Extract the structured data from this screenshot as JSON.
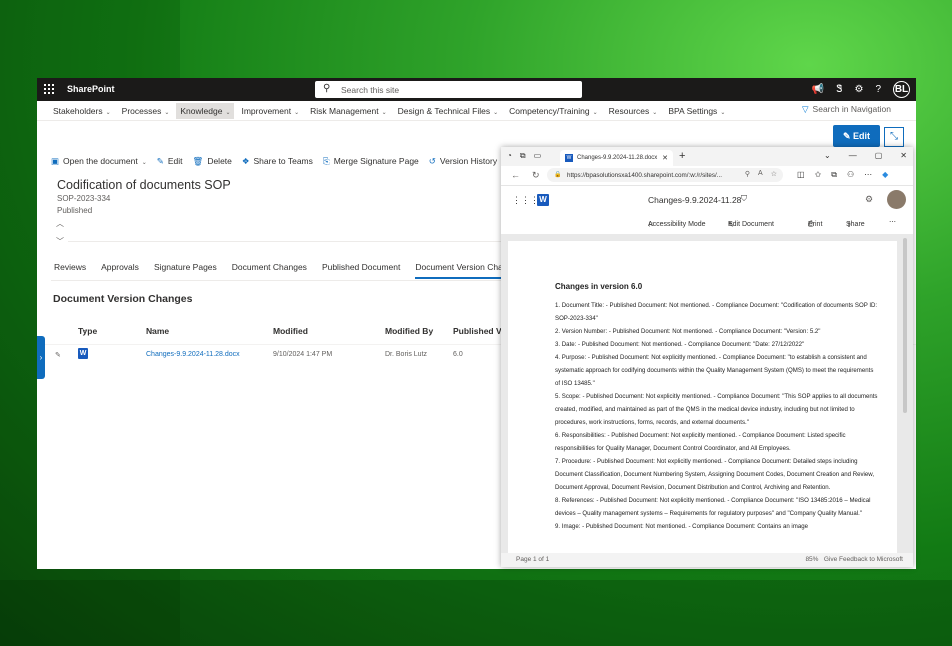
{
  "sharepoint": {
    "brand": "SharePoint",
    "search_placeholder": "Search this site",
    "user_initials": "BL",
    "nav": [
      "Stakeholders",
      "Processes",
      "Knowledge",
      "Improvement",
      "Risk Management",
      "Design & Technical Files",
      "Competency/Training",
      "Resources",
      "BPA Settings"
    ],
    "nav_search": "Search in Navigation",
    "edit_label": "Edit",
    "commands": {
      "open": "Open the document",
      "edit": "Edit",
      "delete": "Delete",
      "share": "Share to Teams",
      "merge": "Merge Signature Page",
      "history": "Version History"
    },
    "doc": {
      "title": "Codification of documents SOP",
      "id": "SOP-2023-334",
      "status": "Published"
    },
    "tabs": [
      "Reviews",
      "Approvals",
      "Signature Pages",
      "Document Changes",
      "Published Document",
      "Document Version Changes"
    ],
    "section_title": "Document Version Changes",
    "table": {
      "headers": [
        "Type",
        "Name",
        "Modified",
        "Modified By",
        "Published Ver"
      ],
      "row": {
        "name": "Changes-9.9.2024-11.28.docx",
        "modified": "9/10/2024 1:47 PM",
        "modified_by": "Dr. Boris Lutz",
        "version": "6.0"
      }
    }
  },
  "edge": {
    "tab_title": "Changes-9.9.2024-11.28.docx",
    "url": "https://bpasolutionsxa1400.sharepoint.com/:w:/r/sites/...",
    "word_title": "Changes-9.9.2024-11.28",
    "toolbar": {
      "accessibility": "Accessibility Mode",
      "edit": "Edit Document",
      "print": "Print",
      "share": "Share"
    },
    "document": {
      "heading": "Changes in version 6.0",
      "items": [
        "1. Document Title:   - Published Document: Not mentioned.    - Compliance Document: \"Codification of documents SOP ID: SOP-2023-334\"",
        "2. Version Number:    - Published Document: Not mentioned.    - Compliance Document: \"Version: 5.2\"",
        "3. Date:    - Published Document: Not mentioned.    - Compliance Document: \"Date: 27/12/2022\"",
        "4. Purpose:    - Published Document: Not explicitly mentioned.    - Compliance Document: \"to establish a consistent and systematic approach for codifying documents within the Quality Management System (QMS) to meet the requirements of ISO 13485.\"",
        "5. Scope:    - Published Document: Not explicitly mentioned.    - Compliance Document: \"This SOP applies to all documents created, modified, and maintained as part of the QMS in the medical device industry, including but not limited to procedures, work instructions, forms, records, and external documents.\"",
        "6. Responsibilities:    - Published Document: Not explicitly mentioned.    - Compliance Document: Listed specific responsibilities for Quality Manager, Document Control Coordinator, and All Employees.",
        "7. Procedure:    - Published Document: Not explicitly mentioned.    - Compliance Document: Detailed steps including Document Classification, Document Numbering System, Assigning Document Codes, Document Creation and Review, Document Approval, Document Revision, Document Distribution and Control, Archiving and Retention.",
        "8. References:    - Published Document: Not explicitly mentioned.    - Compliance Document: \"ISO 13485:2016 – Medical devices – Quality management systems – Requirements for regulatory purposes\" and \"Company Quality Manual.\"",
        "9. Image:    - Published Document: Not mentioned.    - Compliance Document: Contains an image"
      ]
    },
    "status": {
      "page": "Page 1 of 1",
      "zoom": "85%",
      "feedback": "Give Feedback to Microsoft"
    }
  }
}
